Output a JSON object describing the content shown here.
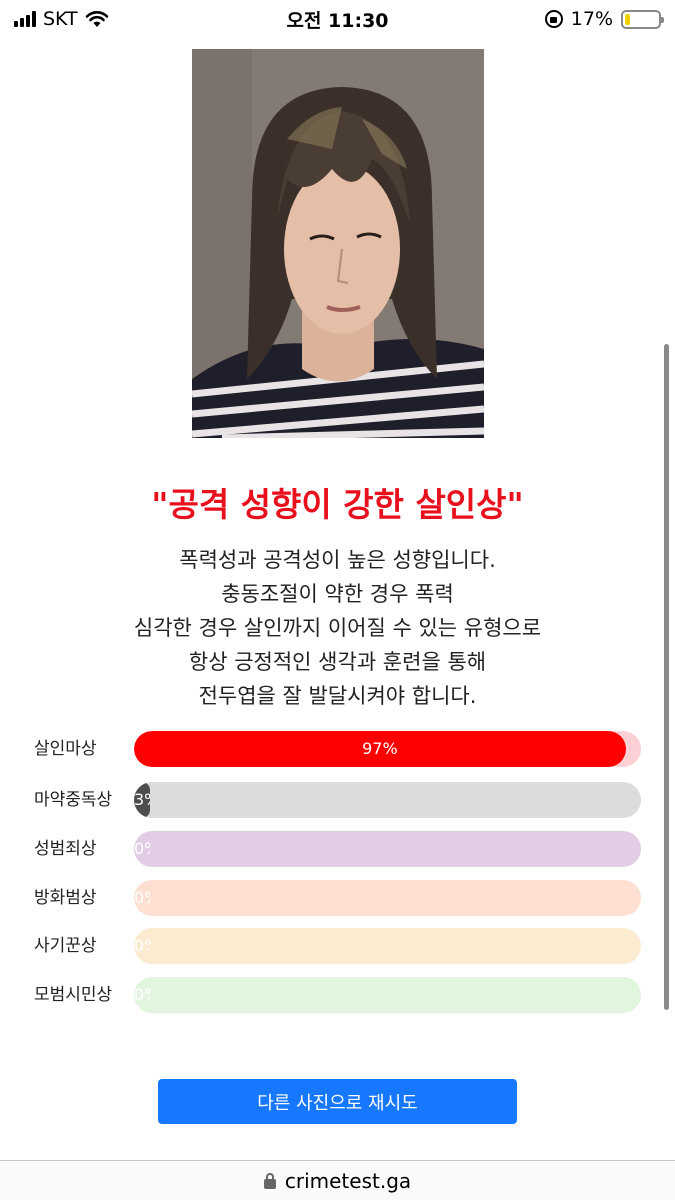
{
  "status_bar": {
    "carrier": "SKT",
    "time": "오전 11:30",
    "battery": "17%",
    "battery_level": 0.17,
    "icons": [
      "signal-icon",
      "wifi-icon",
      "rotation-lock-icon",
      "battery-icon"
    ]
  },
  "photo": {
    "icon": "portrait-photo"
  },
  "result": {
    "title": "\"공격 성향이 강한 살인상\"",
    "description": [
      "폭력성과 공격성이 높은 성향입니다.",
      "충동조절이 약한 경우 폭력",
      "심각한 경우 살인까지 이어질 수 있는 유형으로",
      "항상 긍정적인 생각과 훈련을 통해",
      "전두엽을 잘 발달시켜야 합니다."
    ]
  },
  "bars": [
    {
      "label": "살인마상",
      "percent": 97,
      "text": "97%",
      "track_color": "#fcd0d4",
      "fill_color": "#ff0000"
    },
    {
      "label": "마약중독상",
      "percent": 3,
      "text": "3%",
      "track_color": "#dcdcdc",
      "fill_color": "#4d4d4d"
    },
    {
      "label": "성범죄상",
      "percent": 0,
      "text": "0%",
      "track_color": "#e2cee4",
      "fill_color": "#e2cee4"
    },
    {
      "label": "방화범상",
      "percent": 0,
      "text": "0%",
      "track_color": "#fde0d1",
      "fill_color": "#fde0d1"
    },
    {
      "label": "사기꾼상",
      "percent": 0,
      "text": "0%",
      "track_color": "#fcebd0",
      "fill_color": "#fcebd0"
    },
    {
      "label": "모범시민상",
      "percent": 0,
      "text": "0%",
      "track_color": "#e2f5de",
      "fill_color": "#e2f5de"
    }
  ],
  "retry_button": {
    "label": "다른 사진으로 재시도",
    "color": "#1677ff"
  },
  "url_bar": {
    "url": "crimetest.ga",
    "icon": "lock-icon"
  },
  "accent_color": "#e8101d"
}
